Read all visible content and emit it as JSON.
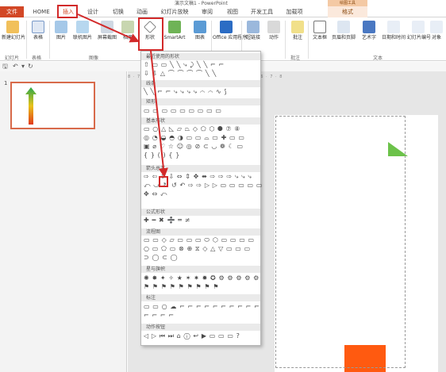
{
  "window": {
    "title": "演示文稿1 - PowerPoint",
    "context_group": "绘图工具"
  },
  "tabs": [
    "文件",
    "HOME",
    "插入",
    "设计",
    "切换",
    "动画",
    "幻灯片放映",
    "审阅",
    "视图",
    "开发工具",
    "加载项",
    "格式"
  ],
  "ribbon": {
    "buttons": [
      "新建幻灯片",
      "表格",
      "图片",
      "联机图片",
      "屏幕截图",
      "相册",
      "形状",
      "SmartArt",
      "图表",
      "Office 应用程序",
      "超链接",
      "动作",
      "批注",
      "文本框",
      "页眉和页脚",
      "艺术字",
      "日期和时间",
      "幻灯片编号",
      "对象"
    ],
    "groups": [
      "幻灯片",
      "表格",
      "图像",
      "批注",
      "文本"
    ]
  },
  "colors": {
    "file_tab": "#d24726",
    "highlight": "#d22a2a",
    "arrow_top": "#2aa84a",
    "arrow_mid": "#e8c21a",
    "arrow_bottom": "#e23a1a"
  },
  "slide_panel": {
    "slide_number": "1"
  },
  "ruler_text": "8 · 7 · 6 · 5 · 4 · 3 · 2 · 1 · 0 · 1 · 2 · 3 · 4 · 5 · 6 · 7 · 8",
  "dropdown": {
    "sections": [
      {
        "title": "最近使用的形状",
        "rows": [
          "⇧ ▭ ▭ ╲ ╲ ⤷ ⤸ ╲ ╲ ⌐ ⌐",
          "⇩ ⇩ △ ⌒ ⌒ ⌒ ⌒ ╲ ╲"
        ]
      },
      {
        "title": "线条",
        "rows": [
          "╲ ╲ ⌐ ⌐ ⤷ ⤷ ⤷ ⤷ ⌒ ⌒ ∿ ⟆"
        ]
      },
      {
        "title": "矩形",
        "rows": [
          "▭ ▭ ▭ ▭ ▭ ▭ ▭ ▭ ▭"
        ]
      },
      {
        "title": "基本形状",
        "rows": [
          "▭ ○ △ ◺ ▱ ⏢ ◇ ⬠ ⬡ ⯃ ⑦ ⑧",
          "◎ ◔ ◒ ◓ ◑ ▭ ▭ ⌓ ▭ ✚ ▭ ▭",
          "▣ ⌀ ♡ ☆ ☺ ◎ ⊘ ⊂ ◡ ❁ ☾ ▭",
          "{ } ( ) { }"
        ]
      },
      {
        "title": "箭头总汇",
        "rows": [
          "⇨ ⇦ ⇧ ⇩ ⇔ ⇕ ✥ ⬌ ⇨ ⇨ ⇨ ⤷ ⤷ ⤷",
          "⤺ ⤻ ↻ ↺ ↶ ⇨ ⇨ ▷ ▷ ▭ ▭ ▭ ▭ ▭",
          "✥ ⇔ ⤺"
        ]
      },
      {
        "title": "公式形状",
        "rows": [
          "✚ ━ ✖ ➗ ═ ≠"
        ]
      },
      {
        "title": "流程图",
        "rows": [
          "▭ ▭ ◇ ▱ ▭ ▭ ▭ ⬭ ⬡ ▭ ▭ ▭ ▭",
          "○ ▭ ⬠ ▭ ⊗ ⊕ ⧖ ◇ △ ▽ ▭ ▭ ▭",
          "⊃ ◯ ⊂ ◯"
        ]
      },
      {
        "title": "星与旗帜",
        "rows": [
          "✺ ✸ ✦ ✧ ★ ✶ ✷ ✹ ✪ ⚙ ⚙ ⚙ ⚙ ⚙",
          "⚑ ⚑ ⚑ ⚑ ⚑ ⚑ ⚑ ⚑ ⚑"
        ]
      },
      {
        "title": "标注",
        "rows": [
          "▭ ▭ ○ ☁ ⌐ ⌐ ⌐ ⌐ ⌐ ⌐ ⌐ ⌐ ⌐ ⌐",
          "⌐ ⌐ ⌐ ⌐"
        ]
      },
      {
        "title": "动作按钮",
        "rows": [
          "◁ ▷ ⏮ ⏭ ⌂ ⓘ ↩ ▶ ▭ ▭ ▭ ?"
        ]
      }
    ]
  }
}
